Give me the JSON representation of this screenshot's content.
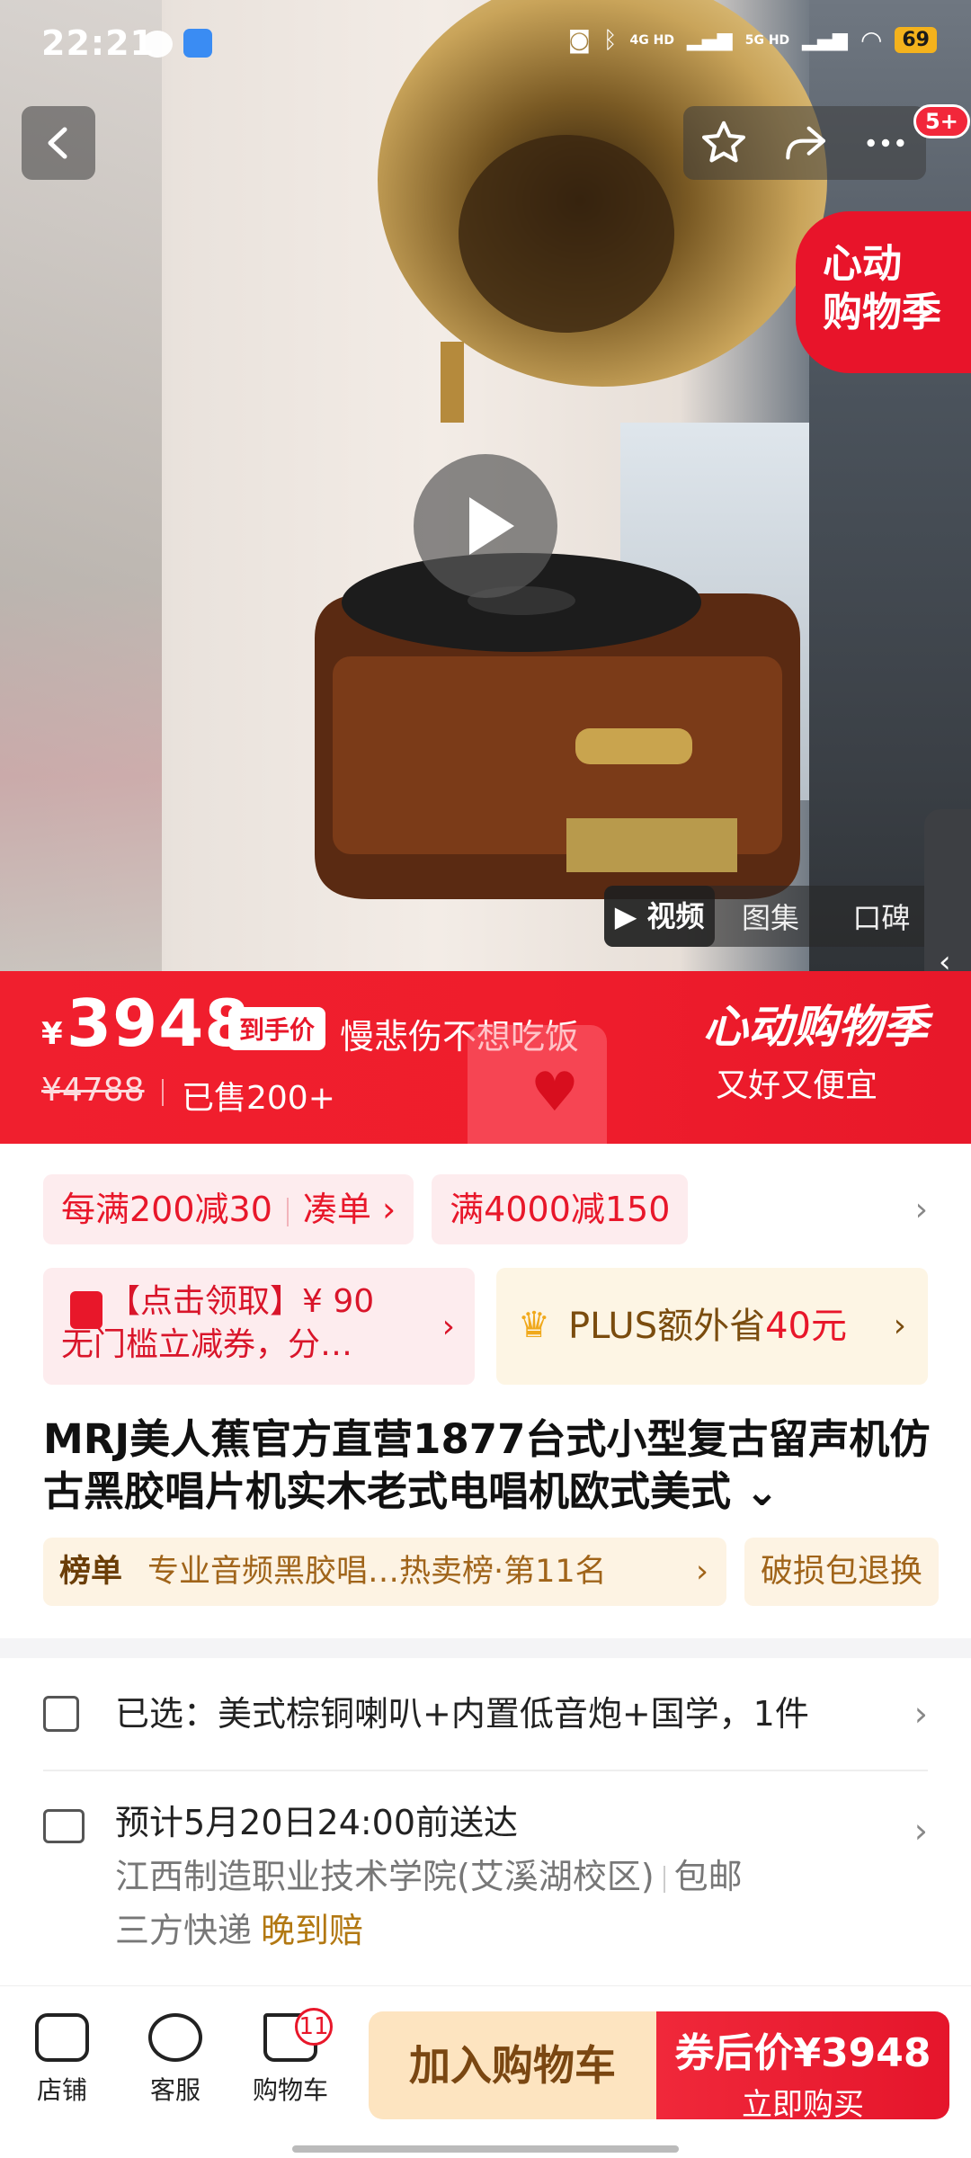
{
  "status_bar": {
    "time": "22:21",
    "battery": "69",
    "net1": "4G HD",
    "net2": "5G HD"
  },
  "header": {
    "more_badge": "5+"
  },
  "hero": {
    "promo_tag_line1": "心动",
    "promo_tag_line2": "购物季",
    "media_tabs": [
      "▶ 视频",
      "图集",
      "口碑"
    ],
    "active_tab": "视频"
  },
  "price": {
    "currency": "¥",
    "current": "3948",
    "tag": "到手价",
    "danmu": "慢悲伤不想吃饭",
    "original": "¥4788",
    "sold": "已售200+",
    "festival_title": "心动购物季",
    "festival_sub": "又好又便宜"
  },
  "coupons": {
    "chip1_a": "每满200减30",
    "chip1_b": "凑单 ›",
    "chip2": "满4000减150",
    "redeem_line1": "【点击领取】¥ 90",
    "redeem_line2": "无门槛立减券，分…",
    "plus_text": "PLUS额外省",
    "plus_amount": "40元"
  },
  "product": {
    "title": "MRJ美人蕉官方直营1877台式小型复古留声机仿古黑胶唱片机实木老式电唱机欧式美式 ⌄",
    "rank_label": "榜单",
    "rank_text": "专业音频黑胶唱…热卖榜·第11名",
    "return_tag": "破损包退换"
  },
  "spec": {
    "selected": "已选：美式棕铜喇叭+内置低音炮+国学，1件"
  },
  "shipping": {
    "eta": "预计5月20日24:00前送达",
    "address": "江西制造职业技术学院(艾溪湖校区)",
    "free_ship": "包邮",
    "carrier": "三方快递",
    "late_comp": "晚到赔"
  },
  "bottom_bar": {
    "store": "店铺",
    "service": "客服",
    "cart": "购物车",
    "cart_count": "11",
    "add_to_cart": "加入购物车",
    "coupon_price": "券后价¥3948",
    "buy_now": "立即购买"
  },
  "colors": {
    "accent": "#e8172a",
    "gold": "#a0641a"
  }
}
